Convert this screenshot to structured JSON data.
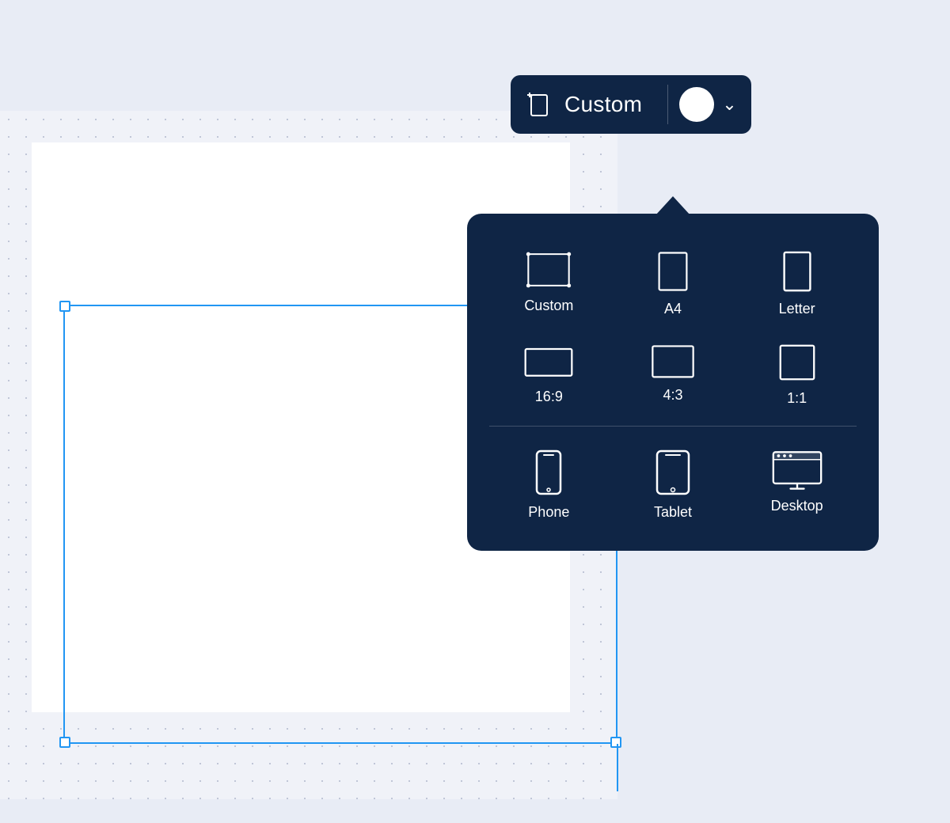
{
  "toolbar": {
    "title": "Custom",
    "new_icon_label": "new-document-icon",
    "chevron_label": "chevron-down-icon",
    "color_circle_label": "color-picker"
  },
  "dropdown": {
    "items_row1": [
      {
        "id": "custom",
        "label": "Custom"
      },
      {
        "id": "a4",
        "label": "A4"
      },
      {
        "id": "letter",
        "label": "Letter"
      }
    ],
    "items_row2": [
      {
        "id": "16:9",
        "label": "16:9"
      },
      {
        "id": "4:3",
        "label": "4:3"
      },
      {
        "id": "1:1",
        "label": "1:1"
      }
    ],
    "items_row3": [
      {
        "id": "phone",
        "label": "Phone"
      },
      {
        "id": "tablet",
        "label": "Tablet"
      },
      {
        "id": "desktop",
        "label": "Desktop"
      }
    ]
  },
  "colors": {
    "dark_navy": "#0f2545",
    "blue_selection": "#2196F3",
    "bg": "#e8ecf5",
    "canvas_bg": "#f0f2f8",
    "white": "#ffffff"
  }
}
